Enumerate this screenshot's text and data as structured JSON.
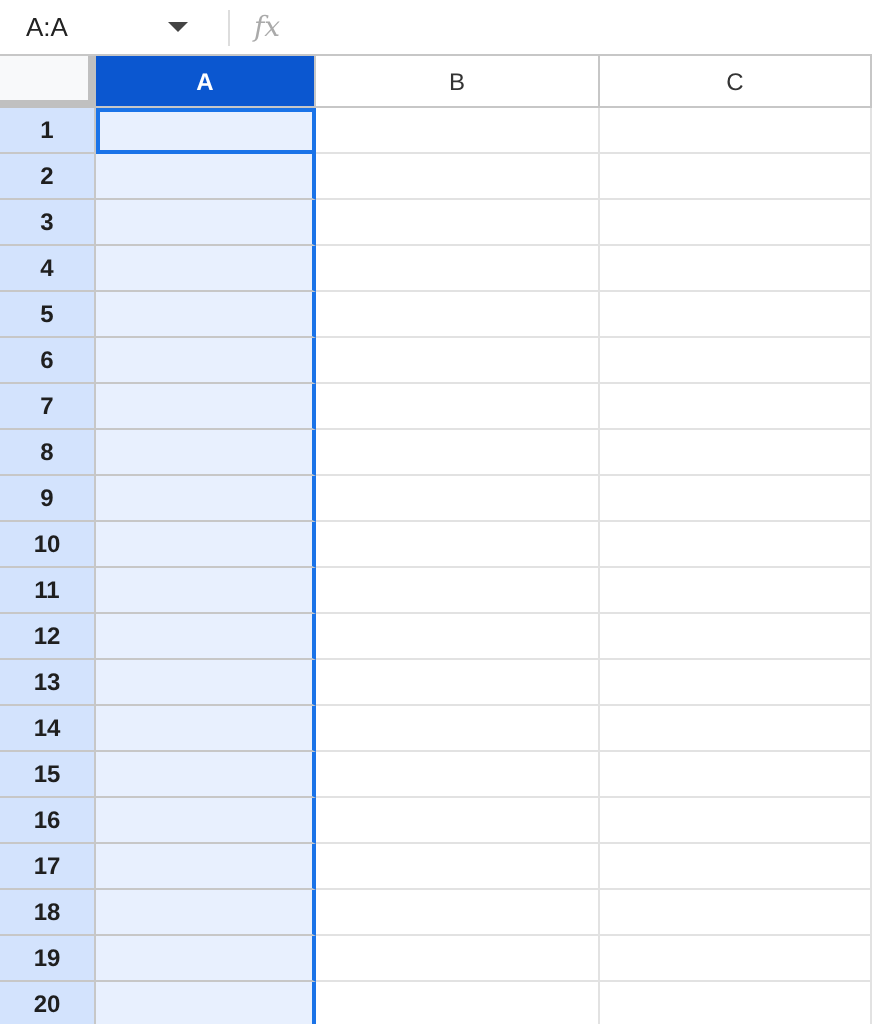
{
  "name_box": {
    "value": "A:A"
  },
  "formula_bar": {
    "fx": "fx"
  },
  "columns": [
    {
      "label": "A",
      "selected": true
    },
    {
      "label": "B",
      "selected": false
    },
    {
      "label": "C",
      "selected": false
    }
  ],
  "rows": [
    {
      "label": "1",
      "selected": true,
      "active": true
    },
    {
      "label": "2",
      "selected": true,
      "active": false
    },
    {
      "label": "3",
      "selected": true,
      "active": false
    },
    {
      "label": "4",
      "selected": true,
      "active": false
    },
    {
      "label": "5",
      "selected": true,
      "active": false
    },
    {
      "label": "6",
      "selected": true,
      "active": false
    },
    {
      "label": "7",
      "selected": true,
      "active": false
    },
    {
      "label": "8",
      "selected": true,
      "active": false
    },
    {
      "label": "9",
      "selected": true,
      "active": false
    },
    {
      "label": "10",
      "selected": true,
      "active": false
    },
    {
      "label": "11",
      "selected": true,
      "active": false
    },
    {
      "label": "12",
      "selected": true,
      "active": false
    },
    {
      "label": "13",
      "selected": true,
      "active": false
    },
    {
      "label": "14",
      "selected": true,
      "active": false
    },
    {
      "label": "15",
      "selected": true,
      "active": false
    },
    {
      "label": "16",
      "selected": true,
      "active": false
    },
    {
      "label": "17",
      "selected": true,
      "active": false
    },
    {
      "label": "18",
      "selected": true,
      "active": false
    },
    {
      "label": "19",
      "selected": true,
      "active": false
    },
    {
      "label": "20",
      "selected": true,
      "active": false
    }
  ]
}
